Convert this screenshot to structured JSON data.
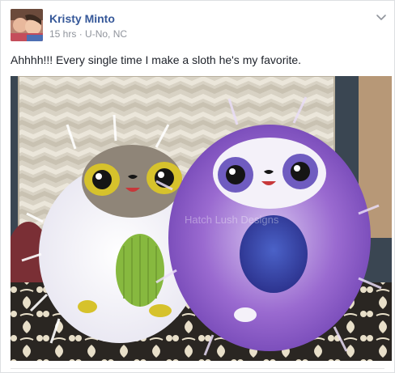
{
  "post": {
    "author": "Kristy Minto",
    "time": "15 hrs",
    "separator": "·",
    "location": "U-No, NC",
    "text": "Ahhhh!!! Every single time I make a sloth he's my favorite.",
    "photo_watermark": "Hatch Lush Designs"
  },
  "icons": {
    "menu": "chevron-down-icon"
  },
  "colors": {
    "author_link": "#365899",
    "meta_text": "#90949c",
    "body_text": "#1d2129"
  }
}
